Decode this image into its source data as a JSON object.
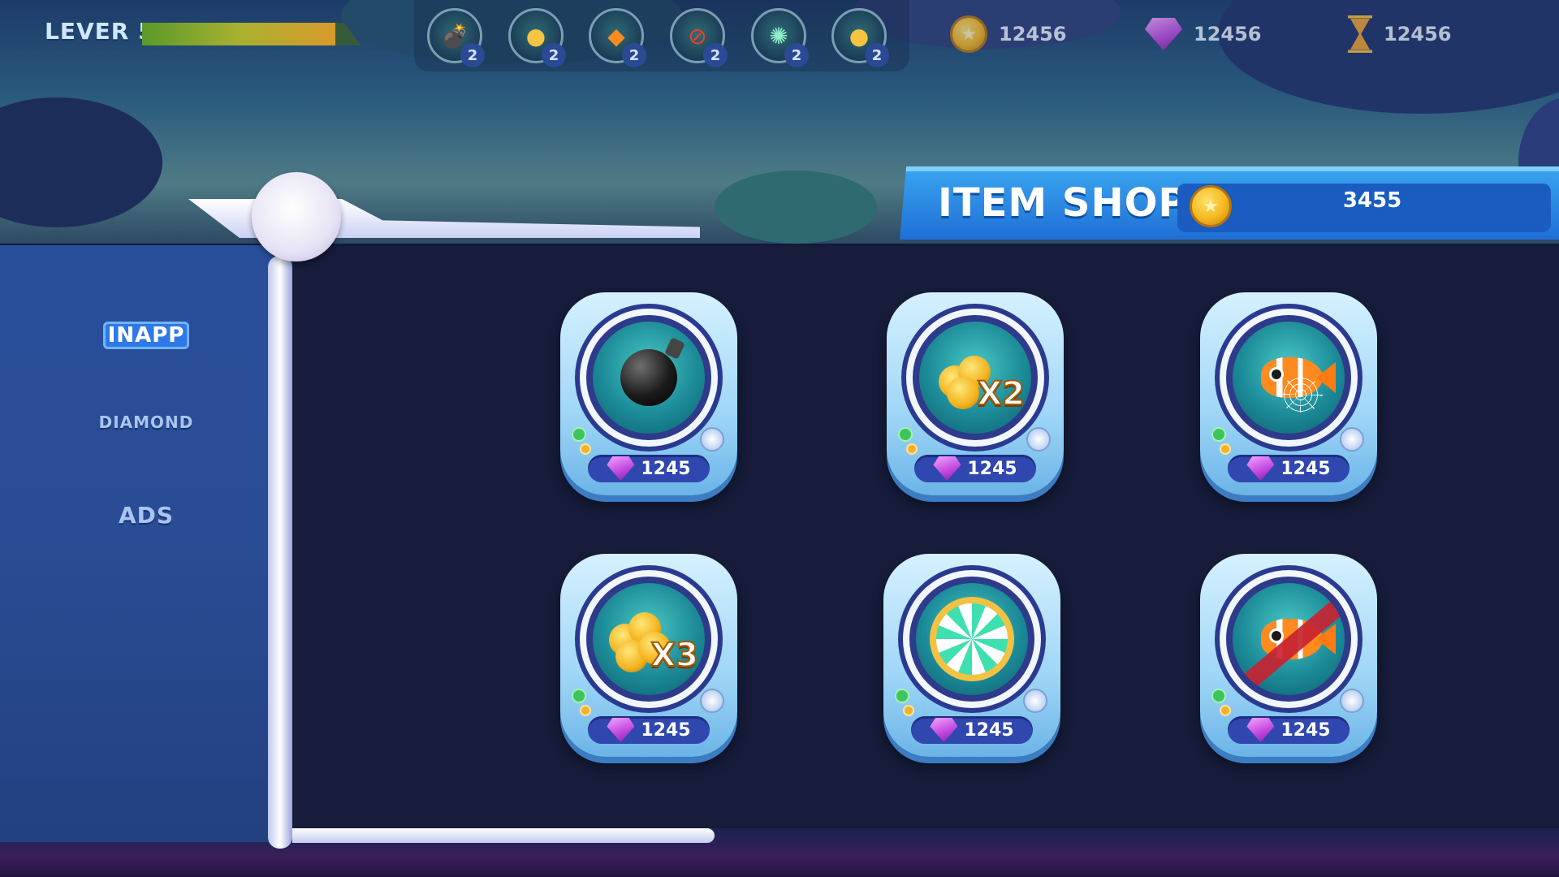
{
  "hud": {
    "level_label": "LEVER 5",
    "level_progress": 0.88,
    "boosters": [
      {
        "name": "bomb",
        "icon": "bomb-icon",
        "count": "2"
      },
      {
        "name": "coins x2",
        "icon": "coins-x2-icon",
        "count": "2"
      },
      {
        "name": "fish net",
        "icon": "fish-net-icon",
        "count": "2"
      },
      {
        "name": "no fish",
        "icon": "no-fish-icon",
        "count": "2"
      },
      {
        "name": "wheel",
        "icon": "wheel-icon",
        "count": "2"
      },
      {
        "name": "coins x3",
        "icon": "coins-x3-icon",
        "count": "2"
      }
    ],
    "coins": "12456",
    "gems": "12456",
    "time": "12456"
  },
  "sidebar": {
    "tabs": [
      {
        "label": "INAPP",
        "active": true
      },
      {
        "label": "DIAMOND",
        "active": false
      },
      {
        "label": "ADS",
        "active": false
      }
    ]
  },
  "shop": {
    "title": "ITEM SHOP",
    "balance": "3455",
    "items": [
      {
        "name": "bomb",
        "icon": "bomb-icon",
        "price": "1245"
      },
      {
        "name": "coins x2",
        "icon": "coins-x2-icon",
        "multiplier": "X2",
        "price": "1245"
      },
      {
        "name": "fish net",
        "icon": "fish-net-icon",
        "price": "1245"
      },
      {
        "name": "coins x3",
        "icon": "coins-x3-icon",
        "multiplier": "X3",
        "price": "1245"
      },
      {
        "name": "lucky wheel",
        "icon": "wheel-icon",
        "price": "1245"
      },
      {
        "name": "no fish",
        "icon": "no-fish-icon",
        "price": "1245"
      }
    ]
  },
  "colors": {
    "header_blue": "#1f6fd6",
    "panel_dark": "#161c3a",
    "sidebar_blue": "#294f9b",
    "price_pill": "#3047b0",
    "coin_gold": "#f5b81f",
    "gem_purple": "#c44ae0"
  }
}
